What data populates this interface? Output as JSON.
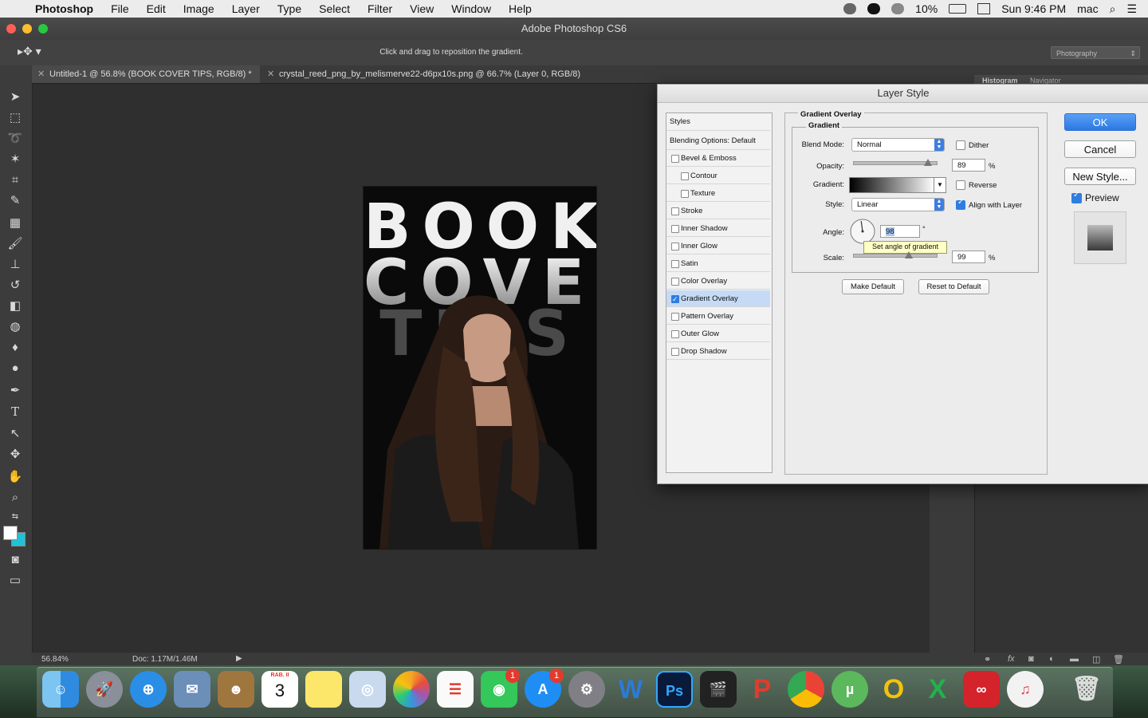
{
  "menubar": {
    "app_name": "Photoshop",
    "items": [
      "File",
      "Edit",
      "Image",
      "Layer",
      "Type",
      "Select",
      "Filter",
      "View",
      "Window",
      "Help"
    ],
    "battery": "10%",
    "clock": "Sun 9:46 PM",
    "user": "mac"
  },
  "window": {
    "title": "Adobe Photoshop CS6"
  },
  "options_bar": {
    "hint": "Click and drag to reposition the gradient.",
    "workspace": "Photography"
  },
  "tabs": [
    {
      "label": "Untitled-1 @ 56.8% (BOOK COVER TIPS, RGB/8) *"
    },
    {
      "label": "crystal_reed_png_by_melismerve22-d6px10s.png @ 66.7% (Layer 0, RGB/8)"
    }
  ],
  "canvas": {
    "words": [
      "BOOK",
      "COVER",
      "TIPS"
    ]
  },
  "status": {
    "zoom": "56.84%",
    "doc": "Doc: 1.17M/1.46M"
  },
  "right_panel": {
    "tabs": [
      "Histogram",
      "Navigator"
    ]
  },
  "dialog": {
    "title": "Layer Style",
    "styles_header": "Styles",
    "blending": "Blending Options: Default",
    "styles": [
      {
        "label": "Bevel & Emboss",
        "checked": false,
        "sub": false
      },
      {
        "label": "Contour",
        "checked": false,
        "sub": true
      },
      {
        "label": "Texture",
        "checked": false,
        "sub": true
      },
      {
        "label": "Stroke",
        "checked": false,
        "sub": false
      },
      {
        "label": "Inner Shadow",
        "checked": false,
        "sub": false
      },
      {
        "label": "Inner Glow",
        "checked": false,
        "sub": false
      },
      {
        "label": "Satin",
        "checked": false,
        "sub": false
      },
      {
        "label": "Color Overlay",
        "checked": false,
        "sub": false
      },
      {
        "label": "Gradient Overlay",
        "checked": true,
        "sub": false,
        "selected": true
      },
      {
        "label": "Pattern Overlay",
        "checked": false,
        "sub": false
      },
      {
        "label": "Outer Glow",
        "checked": false,
        "sub": false
      },
      {
        "label": "Drop Shadow",
        "checked": false,
        "sub": false
      }
    ],
    "section_title": "Gradient Overlay",
    "group_title": "Gradient",
    "blend_mode_label": "Blend Mode:",
    "blend_mode": "Normal",
    "dither_label": "Dither",
    "opacity_label": "Opacity:",
    "opacity": "89",
    "opacity_level": 89,
    "percent": "%",
    "gradient_label": "Gradient:",
    "reverse_label": "Reverse",
    "style_label": "Style:",
    "style": "Linear",
    "align_label": "Align with Layer",
    "align_checked": true,
    "angle_label": "Angle:",
    "angle": "98",
    "degree": "°",
    "tooltip": "Set angle of gradient",
    "scale_label": "Scale:",
    "scale": "99",
    "scale_level": 99,
    "make_default": "Make Default",
    "reset_default": "Reset to Default",
    "ok": "OK",
    "cancel": "Cancel",
    "new_style": "New Style...",
    "preview_label": "Preview",
    "preview_checked": true
  },
  "dock": {
    "calendar_month": "RAB. II",
    "calendar_day": "3",
    "facetime_badge": "1",
    "appstore_badge": "1"
  },
  "colors": {
    "accent": "#2b78e4",
    "foreground_swatch": "#ffffff",
    "background_swatch": "#1fc3d9"
  }
}
